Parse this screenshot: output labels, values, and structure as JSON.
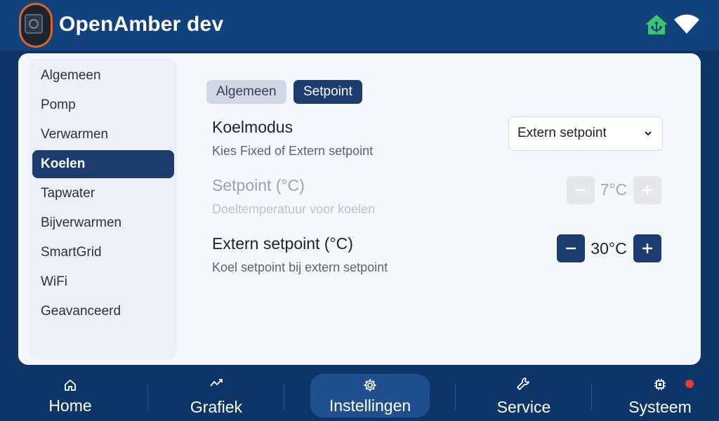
{
  "header": {
    "title": "OpenAmber dev",
    "logo_icon": "heat-pump-logo",
    "status_icons": [
      "home-network-icon",
      "wifi-icon"
    ],
    "home_icon_color": "#3ec46d"
  },
  "sidebar": {
    "items": [
      {
        "label": "Algemeen",
        "active": false
      },
      {
        "label": "Pomp",
        "active": false
      },
      {
        "label": "Verwarmen",
        "active": false
      },
      {
        "label": "Koelen",
        "active": true
      },
      {
        "label": "Tapwater",
        "active": false
      },
      {
        "label": "Bijverwarmen",
        "active": false
      },
      {
        "label": "SmartGrid",
        "active": false
      },
      {
        "label": "WiFi",
        "active": false
      },
      {
        "label": "Geavanceerd",
        "active": false
      }
    ]
  },
  "tabs": [
    {
      "label": "Algemeen",
      "active": false
    },
    {
      "label": "Setpoint",
      "active": true
    }
  ],
  "settings": {
    "koelmodus": {
      "title": "Koelmodus",
      "description": "Kies Fixed of Extern setpoint",
      "selected": "Extern setpoint"
    },
    "setpoint": {
      "title": "Setpoint (°C)",
      "description": "Doeltemperatuur voor koelen",
      "value": "7°C",
      "enabled": false
    },
    "extern_setpoint": {
      "title": "Extern setpoint (°C)",
      "description": "Koel setpoint bij extern setpoint",
      "value": "30°C",
      "enabled": true
    }
  },
  "nav": {
    "items": [
      {
        "label": "Home",
        "icon": "home-icon",
        "active": false
      },
      {
        "label": "Grafiek",
        "icon": "chart-icon",
        "active": false
      },
      {
        "label": "Instellingen",
        "icon": "gear-icon",
        "active": true
      },
      {
        "label": "Service",
        "icon": "wrench-icon",
        "active": false
      },
      {
        "label": "Systeem",
        "icon": "chip-icon",
        "active": false
      }
    ],
    "alert_color": "#e53935"
  },
  "colors": {
    "header_bg": "#12427d",
    "accent": "#1c3b6e",
    "panel_bg": "#f4f8fc"
  }
}
